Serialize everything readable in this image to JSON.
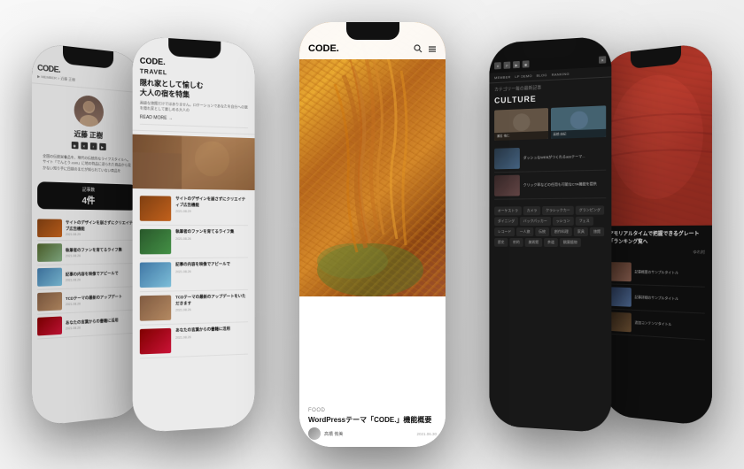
{
  "scene": {
    "bg": "#f0f0f0"
  },
  "phones": {
    "phone1": {
      "name": "profile-phone",
      "logo": "CODE.",
      "breadcrumb": "▶ MEMBER > 近藤 正樹",
      "profile_name": "近藤 正樹",
      "bio": "全国の伝統栄養品を、現代の伝統的なライフスタイルへ。サイト「でんとう.com」に地の特品に送られた商品から見かない知り手に目録のまだが知られていない商品を",
      "stats_label": "記事数",
      "stats_count": "4件",
      "posts": [
        {
          "title": "サイトのデザインを崩さずにクリエイティブ広告機能",
          "date": "2021.08.29"
        },
        {
          "title": "執筆者のファンを育てるライフ集",
          "date": "2021.08.26"
        },
        {
          "title": "記事の内容を映像でアピールで",
          "date": "2021.08.26"
        },
        {
          "title": "TCDテーマの最新のアップデートをいただきます",
          "date": "2021.08.26"
        },
        {
          "title": "あなたの言葉からの書籍に活用",
          "date": "2021.08.26"
        }
      ]
    },
    "phone2": {
      "name": "travel-phone",
      "logo": "CODE.",
      "category": "TRAVEL",
      "headline": "隠れ家として愉しむ\n大人の宿を特集",
      "subtext": "高級な旅館だけではありません。ロケーションであなたを自分への旅を隠れ家として楽しめる大人の",
      "read_more": "READ MORE →",
      "posts": [
        {
          "title": "サイトのデザインを崩さずにクリエイティブ広告機能",
          "date": "2021.08.29"
        },
        {
          "title": "執筆者のファンを育てるライフ集",
          "date": "2021.08.26"
        },
        {
          "title": "記事の内容を映像でアピールで",
          "date": "2021.08.26"
        },
        {
          "title": "TCDテーマの最新のアップデートを",
          "date": "2021.08.26"
        },
        {
          "title": "あなたの言葉からの書籍に活用",
          "date": "2021.08.26"
        }
      ]
    },
    "phone3": {
      "name": "food-phone",
      "logo": "CODE.",
      "food_category": "FOOD",
      "food_title": "WordPressテーマ「CODE.」機能概要",
      "author_name": "高橋 侑美",
      "date": "2021.06.30"
    },
    "phone4": {
      "name": "dark-phone",
      "nav_items": [
        "MEMBER",
        "LP DEMO",
        "BLOG",
        "RANKING"
      ],
      "section": "カテゴリー毎の最新記事",
      "culture_title": "CULTURE",
      "posts": [
        {
          "title": "ダッシュなWEBがつくれるassテーマ...",
          "author": "瀬名 侑仁"
        },
        {
          "title": "クリック率などの任用も可能な4複雑のCTA機能を提供",
          "author": "高橋 由紀"
        }
      ],
      "tags": [
        "オーケストラ",
        "カメラ",
        "クラシックカー",
        "グランピング",
        "ダイニング",
        "バックパッカー",
        "ッション",
        "フェス",
        "レコード",
        "一人旅",
        "伝統",
        "創作料理",
        "アウト",
        "家具",
        "旅館",
        "旅館",
        "歴史",
        "射的",
        "鱼山",
        "美術館",
        "茶道",
        "観葉植物"
      ]
    },
    "phone5": {
      "name": "rightmost-phone",
      "title": "アモリアルタイムで把握できるグレート「ランキング覧へ",
      "author": "ゆれ村",
      "posts": [
        {
          "title": "記事概要"
        },
        {
          "title": "記事詳細"
        }
      ]
    }
  }
}
